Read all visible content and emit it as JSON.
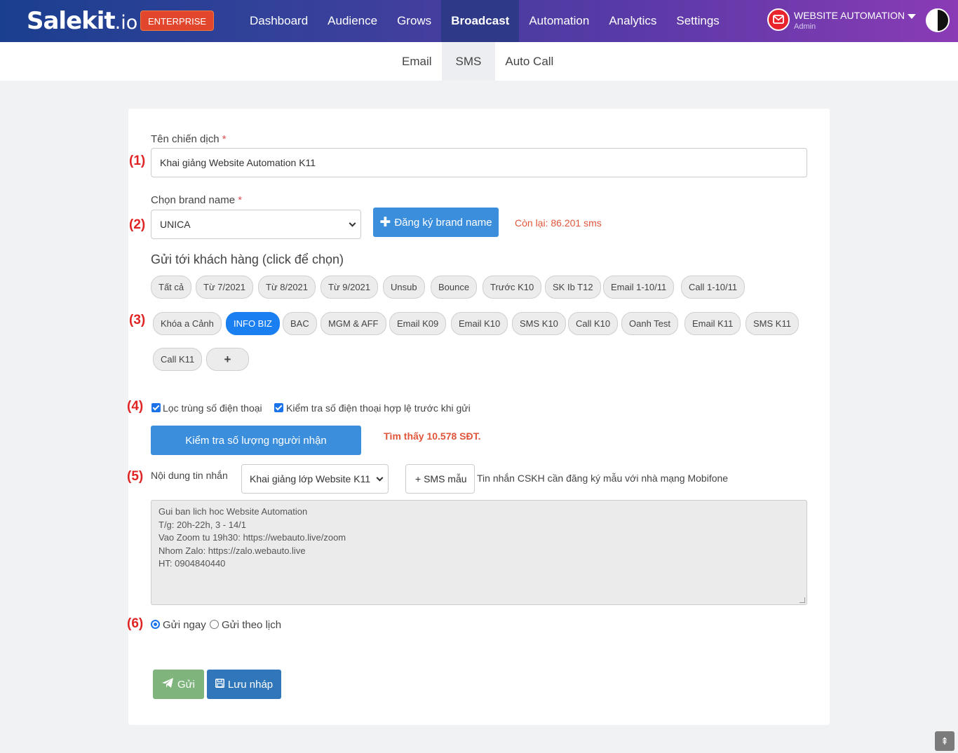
{
  "brand": {
    "logo_main": "Salekit",
    "logo_suffix": ".io",
    "tier": "ENTERPRISE"
  },
  "nav": {
    "items": [
      "Dashboard",
      "Audience",
      "Grows",
      "Broadcast",
      "Automation",
      "Analytics",
      "Settings"
    ],
    "active": "Broadcast"
  },
  "user": {
    "name": "WEBSITE AUTOMATION",
    "role": "Admin"
  },
  "subnav": {
    "tabs": [
      "Email",
      "SMS",
      "Auto Call"
    ],
    "active": "SMS"
  },
  "steps": [
    "(1)",
    "(2)",
    "(3)",
    "(4)",
    "(5)",
    "(6)"
  ],
  "form": {
    "campaign_label": "Tên chiến dịch",
    "required_mark": "*",
    "campaign_value": "Khai giảng Website Automation K11",
    "brand_label": "Chọn brand name",
    "brand_value": "UNICA",
    "register_brand": "Đăng ký brand name",
    "remaining": "Còn lại: 86.201 sms",
    "send_to_title": "Gửi tới khách hàng (click để chọn)",
    "segments_row1": [
      "Tất cả",
      "Từ 7/2021",
      "Từ 8/2021",
      "Từ 9/2021",
      "Unsub",
      "Bounce",
      "Trước K10",
      "SK Ib T12",
      "Email 1-10/11",
      "Call 1-10/11"
    ],
    "segments_row2": [
      "Khóa a Cảnh",
      "INFO BIZ",
      "BAC",
      "MGM & AFF",
      "Email K09",
      "Email K10",
      "SMS K10",
      "Call K10",
      "Oanh Test",
      "Email K11",
      "SMS K11"
    ],
    "segments_row3": [
      "Call K11",
      "+"
    ],
    "selected_segment": "INFO BIZ",
    "filter_duplicates": "Lọc trùng số điện thoại",
    "validate_phones": "Kiểm tra số điện thoại hợp lệ trước khi gửi",
    "check_recipients": "Kiểm tra số lượng người nhận",
    "found": "Tìm thấy 10.578 SĐT.",
    "content_label": "Nội dung tin nhắn",
    "template_value": "Khai giảng lớp Website K11",
    "sms_template_btn": "+ SMS mẫu",
    "template_note": "Tin nhắn CSKH cần đăng ký mẫu với nhà mạng Mobifone",
    "message_lines": [
      "Gui ban lich hoc Website Automation",
      "T/g: 20h-22h, 3 - 14/1",
      "Vao Zoom tu 19h30: https://webauto.live/zoom",
      "Nhom Zalo: https://zalo.webauto.live",
      "HT: 0904840440"
    ],
    "send_now": "Gửi ngay",
    "send_scheduled": "Gửi theo lịch",
    "send_btn": "Gửi",
    "draft_btn": "Lưu nháp"
  },
  "colors": {
    "selected_chip": "#1a7ff0",
    "step_red": "#e02424",
    "primary": "#3b8edb",
    "send_green": "#7fb47d"
  }
}
